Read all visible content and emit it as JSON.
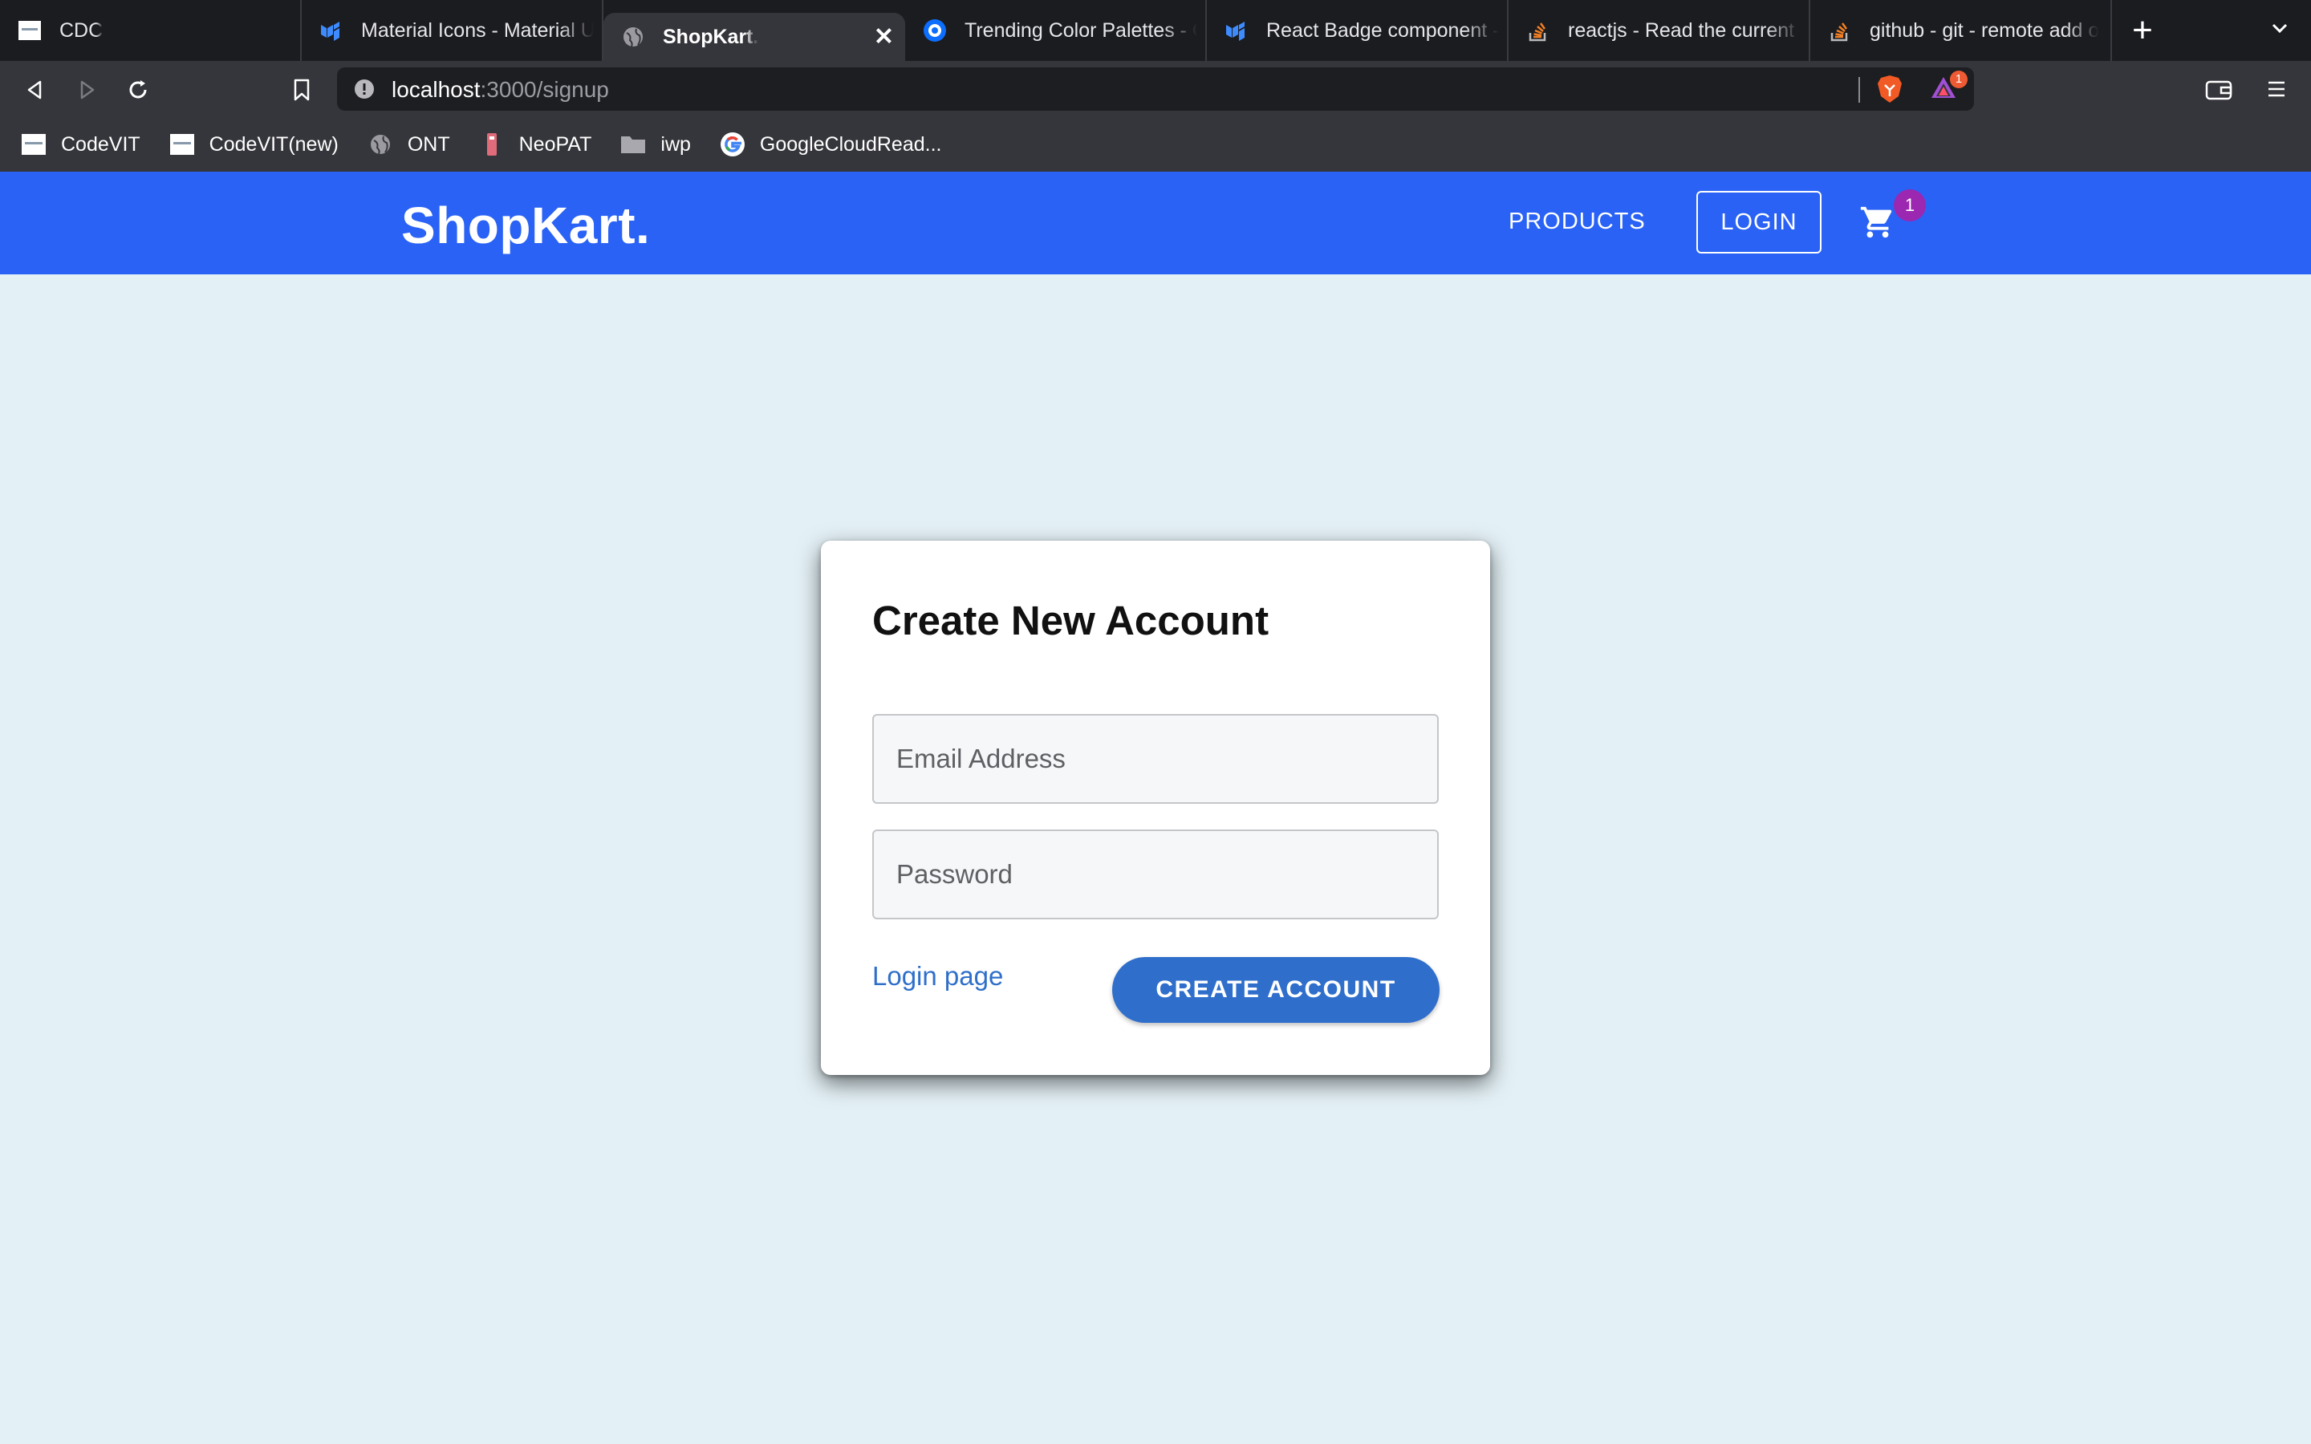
{
  "browser": {
    "tabs": [
      {
        "title": "CDC",
        "icon": "site-thumbnail-icon",
        "active": false
      },
      {
        "title": "Material Icons - Material UI",
        "icon": "mui-logo-icon",
        "active": false
      },
      {
        "title": "ShopKart.",
        "icon": "globe-icon",
        "active": true
      },
      {
        "title": "Trending Color Palettes - C",
        "icon": "coolors-logo-icon",
        "active": false
      },
      {
        "title": "React Badge component -",
        "icon": "mui-logo-icon",
        "active": false
      },
      {
        "title": "reactjs - Read the current f",
        "icon": "stackoverflow-icon",
        "active": false
      },
      {
        "title": "github - git - remote add o",
        "icon": "stackoverflow-icon",
        "active": false
      }
    ],
    "new_tab_label": "+",
    "close_label": "✕",
    "url": {
      "host": "localhost",
      "path": ":3000/signup"
    },
    "rewards_count": "1",
    "bookmarks": [
      {
        "label": "CodeVIT",
        "icon": "site-thumbnail-icon"
      },
      {
        "label": "CodeVIT(new)",
        "icon": "site-thumbnail-icon"
      },
      {
        "label": "ONT",
        "icon": "globe-icon"
      },
      {
        "label": "NeoPAT",
        "icon": "neopat-icon"
      },
      {
        "label": "iwp",
        "icon": "folder-icon"
      },
      {
        "label": "GoogleCloudRead...",
        "icon": "google-icon"
      }
    ]
  },
  "app": {
    "brand": "ShopKart.",
    "nav": {
      "products": "PRODUCTS",
      "login": "LOGIN"
    },
    "cart_count": "1",
    "colors": {
      "appbar": "#2962f5",
      "button": "#2f6fcb",
      "background": "#e3f0f5",
      "badge": "#9c27b0"
    }
  },
  "form": {
    "title": "Create New Account",
    "email_placeholder": "Email Address",
    "email_value": "",
    "password_placeholder": "Password",
    "password_value": "",
    "login_link": "Login page",
    "submit_label": "CREATE ACCOUNT"
  }
}
